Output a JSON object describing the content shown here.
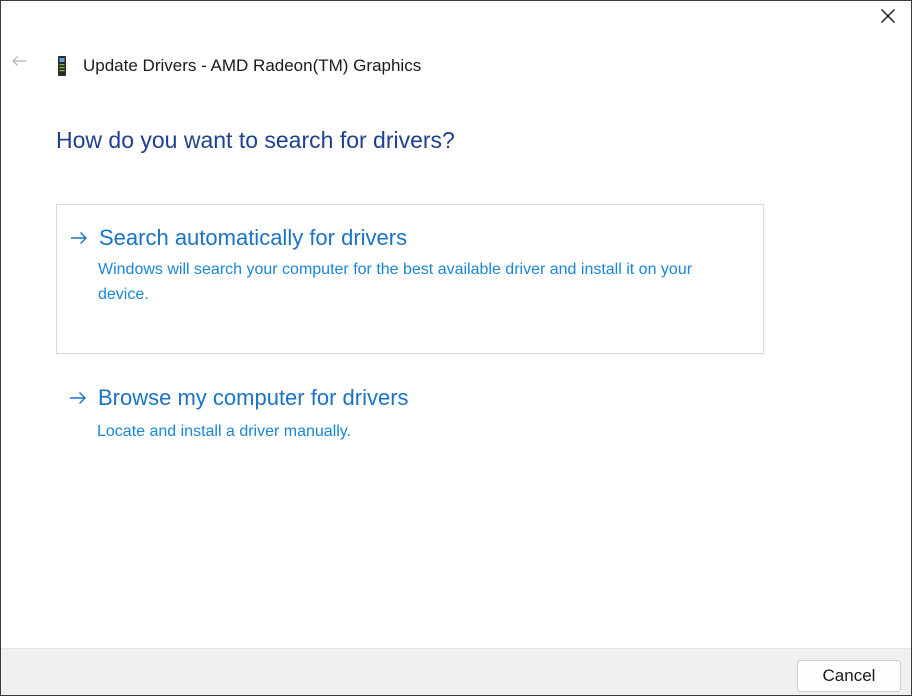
{
  "window": {
    "title": "Update Drivers - AMD Radeon(TM) Graphics",
    "close_icon": "close-icon",
    "back_icon": "back-arrow-icon",
    "device_icon": "display-adapter-icon"
  },
  "main": {
    "heading": "How do you want to search for drivers?",
    "options": [
      {
        "icon": "right-arrow-icon",
        "title": "Search automatically for drivers",
        "description": "Windows will search your computer for the best available driver and install it on your device."
      },
      {
        "icon": "right-arrow-icon",
        "title": "Browse my computer for drivers",
        "description": "Locate and install a driver manually."
      }
    ]
  },
  "footer": {
    "cancel_label": "Cancel"
  },
  "colors": {
    "heading": "#1f3f8f",
    "link": "#1a73c7",
    "link_desc": "#1a86d8",
    "footer_bg": "#f0f0f0"
  }
}
